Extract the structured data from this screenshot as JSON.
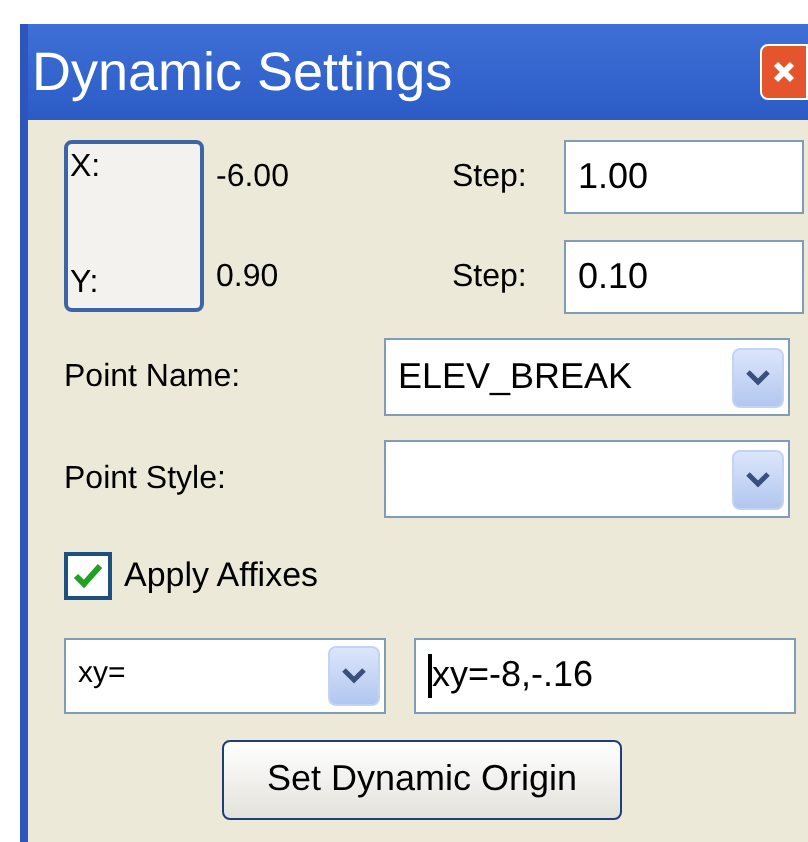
{
  "window": {
    "title": "Dynamic Settings"
  },
  "coordinates": [
    {
      "axis_label": "X:",
      "value": "-6.00",
      "step_label": "Step:",
      "step": "1.00"
    },
    {
      "axis_label": "Y:",
      "value": "0.90",
      "step_label": "Step:",
      "step": "0.10"
    }
  ],
  "point_name": {
    "label": "Point Name:",
    "value": "ELEV_BREAK"
  },
  "point_style": {
    "label": "Point Style:"
  },
  "apply_affixes": {
    "label": "Apply Affixes",
    "checked": true
  },
  "affix": {
    "type": "xy=",
    "value": "xy=-8,-.16",
    "focused": true
  },
  "buttons": [
    "Set Dynamic Origin"
  ]
}
